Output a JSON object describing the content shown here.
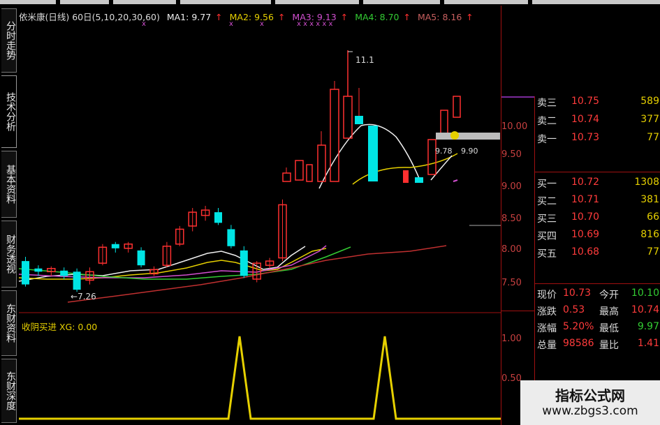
{
  "sidebar": {
    "tabs": [
      "分时走势",
      "技术分析",
      "基本资料",
      "财务透视",
      "东财资料",
      "东财深度"
    ]
  },
  "chart_header": {
    "title": "依米康(日线) 60日(5,10,20,30,60)",
    "ma1": "MA1: 9.77",
    "ma2": "MA2: 9.56",
    "ma3": "MA3: 9.13",
    "ma4": "MA4: 8.70",
    "ma5": "MA5: 8.16",
    "arrow": "↑"
  },
  "price_annotations": {
    "high": "11.1",
    "low": "7.26",
    "mid1": "9.78",
    "mid2": "9.90"
  },
  "indicator": {
    "title": "收阴买进 XG: 0.00"
  },
  "y_axis": {
    "ticks": [
      "10.00",
      "9.50",
      "9.00",
      "8.50",
      "8.00",
      "7.50",
      "1.00",
      "0.50"
    ]
  },
  "order_book": {
    "asks": [
      {
        "label": "卖三",
        "price": "10.75",
        "volume": "589"
      },
      {
        "label": "卖二",
        "price": "10.74",
        "volume": "377"
      },
      {
        "label": "卖一",
        "price": "10.73",
        "volume": "77"
      }
    ],
    "bids": [
      {
        "label": "买一",
        "price": "10.72",
        "volume": "1308"
      },
      {
        "label": "买二",
        "price": "10.71",
        "volume": "381"
      },
      {
        "label": "买三",
        "price": "10.70",
        "volume": "66"
      },
      {
        "label": "买四",
        "price": "10.69",
        "volume": "816"
      },
      {
        "label": "买五",
        "price": "10.68",
        "volume": "77"
      }
    ]
  },
  "quote": {
    "rows": [
      {
        "l1": "现价",
        "v1": "10.73",
        "l2": "今开",
        "v2": "10.10",
        "c2": "green"
      },
      {
        "l1": "涨跌",
        "v1": "0.53",
        "l2": "最高",
        "v2": "10.74",
        "c2": "red"
      },
      {
        "l1": "涨幅",
        "v1": "5.20%",
        "l2": "最低",
        "v2": "9.97",
        "c2": "green"
      },
      {
        "l1": "总量",
        "v1": "98586",
        "l2": "量比",
        "v2": "1.41",
        "c2": "red"
      }
    ]
  },
  "watermark": {
    "line1": "指标公式网",
    "line2": "www.zbgs3.com"
  },
  "chart_data": {
    "type": "candlestick",
    "price_range": [
      7.2,
      10.6
    ],
    "candles": [
      {
        "o": 7.62,
        "c": 7.4,
        "h": 7.66,
        "l": 7.38
      },
      {
        "o": 7.55,
        "c": 7.52,
        "h": 7.58,
        "l": 7.48
      },
      {
        "o": 7.52,
        "c": 7.55,
        "h": 7.57,
        "l": 7.48
      },
      {
        "o": 7.53,
        "c": 7.48,
        "h": 7.56,
        "l": 7.45
      },
      {
        "o": 7.52,
        "c": 7.35,
        "h": 7.55,
        "l": 7.33
      },
      {
        "o": 7.44,
        "c": 7.52,
        "h": 7.56,
        "l": 7.4
      },
      {
        "o": 7.6,
        "c": 7.75,
        "h": 7.78,
        "l": 7.58
      },
      {
        "o": 7.78,
        "c": 7.74,
        "h": 7.8,
        "l": 7.7
      },
      {
        "o": 7.74,
        "c": 7.78,
        "h": 7.8,
        "l": 7.7
      },
      {
        "o": 7.72,
        "c": 7.58,
        "h": 7.75,
        "l": 7.56
      },
      {
        "o": 7.5,
        "c": 7.54,
        "h": 7.57,
        "l": 7.48
      },
      {
        "o": 7.58,
        "c": 7.76,
        "h": 7.8,
        "l": 7.56
      },
      {
        "o": 7.78,
        "c": 7.92,
        "h": 7.95,
        "l": 7.76
      },
      {
        "o": 7.95,
        "c": 8.08,
        "h": 8.12,
        "l": 7.9
      },
      {
        "o": 8.05,
        "c": 8.1,
        "h": 8.14,
        "l": 8.0
      },
      {
        "o": 8.08,
        "c": 7.98,
        "h": 8.12,
        "l": 7.96
      },
      {
        "o": 7.92,
        "c": 7.76,
        "h": 7.96,
        "l": 7.74
      },
      {
        "o": 7.72,
        "c": 7.48,
        "h": 7.76,
        "l": 7.46
      },
      {
        "o": 7.45,
        "c": 7.6,
        "h": 7.62,
        "l": 7.42
      },
      {
        "o": 7.58,
        "c": 7.62,
        "h": 7.65,
        "l": 7.55
      },
      {
        "o": 7.65,
        "c": 8.15,
        "h": 8.2,
        "l": 7.62
      }
    ],
    "signals_x": [
      341,
      548
    ]
  }
}
